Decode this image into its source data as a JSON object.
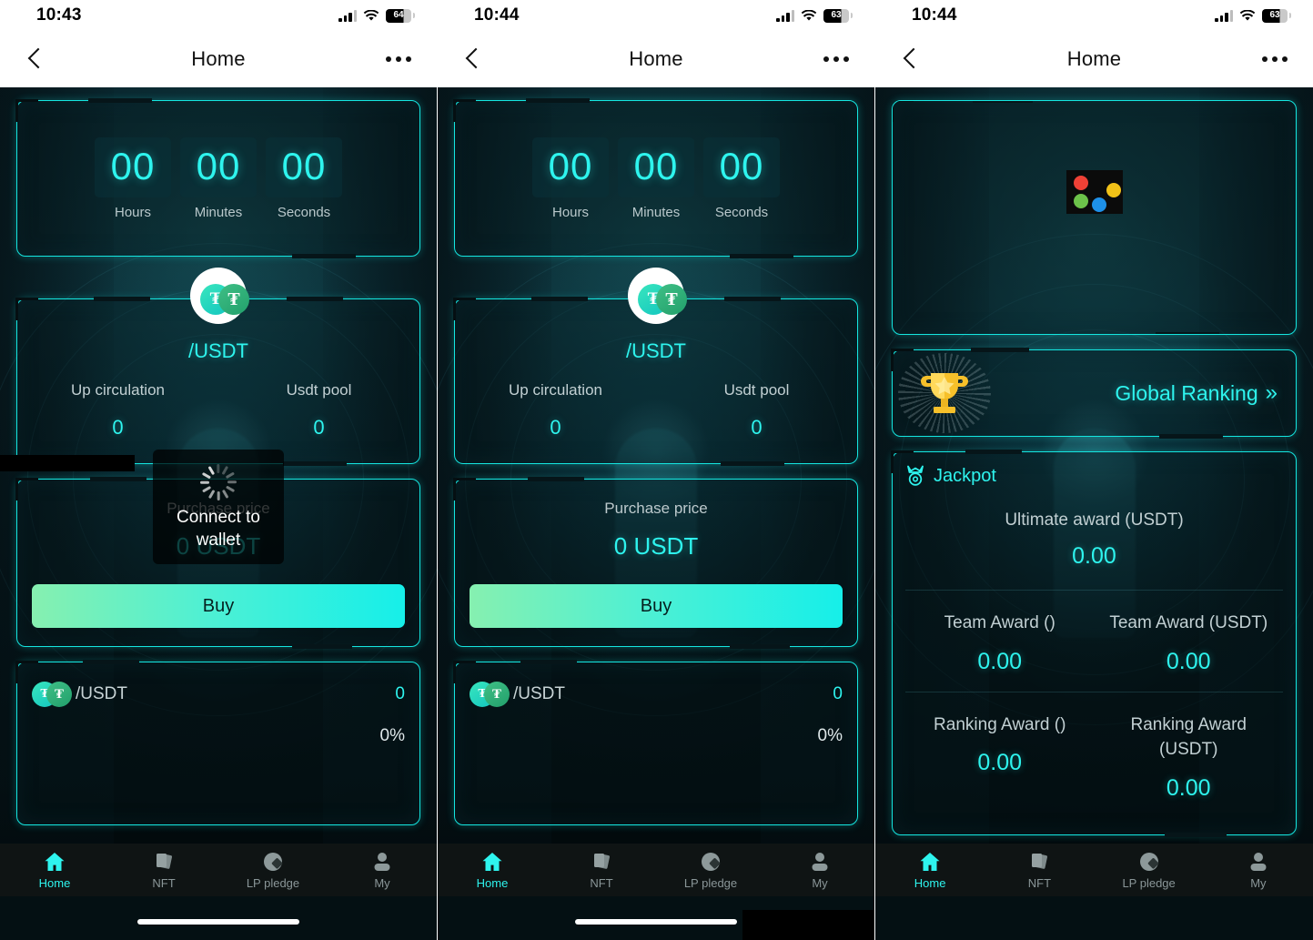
{
  "app": {
    "nav_title": "Home",
    "back_icon": "chevron-left-icon",
    "more_icon": "ellipsis-icon"
  },
  "screens": [
    {
      "status": {
        "time": "10:43",
        "battery": "64",
        "signal_icon": "cellular-signal-icon",
        "wifi_icon": "wifi-icon",
        "battery_icon": "battery-icon"
      },
      "countdown": {
        "cells": [
          {
            "value": "00",
            "label": "Hours"
          },
          {
            "value": "00",
            "label": "Minutes"
          },
          {
            "value": "00",
            "label": "Seconds"
          }
        ]
      },
      "pool": {
        "pair": "/USDT",
        "token_a_glyph": "₮",
        "token_b_glyph": "₮",
        "stats": [
          {
            "label": "Up circulation",
            "value": "0"
          },
          {
            "label": "Usdt pool",
            "value": "0"
          }
        ]
      },
      "purchase": {
        "label": "Purchase price",
        "value": "0 USDT",
        "buy_label": "Buy"
      },
      "list": {
        "pair": "/USDT",
        "amount": "0",
        "percent": "0%"
      },
      "toast": {
        "text": "Connect to wallet",
        "spinner_icon": "loading-spinner-icon"
      }
    },
    {
      "status": {
        "time": "10:44",
        "battery": "63"
      },
      "countdown": {
        "cells": [
          {
            "value": "00",
            "label": "Hours"
          },
          {
            "value": "00",
            "label": "Minutes"
          },
          {
            "value": "00",
            "label": "Seconds"
          }
        ]
      },
      "pool": {
        "pair": "/USDT",
        "stats": [
          {
            "label": "Up circulation",
            "value": "0"
          },
          {
            "label": "Usdt pool",
            "value": "0"
          }
        ]
      },
      "purchase": {
        "label": "Purchase price",
        "value": "0 USDT",
        "buy_label": "Buy"
      },
      "list": {
        "pair": "/USDT",
        "amount": "0",
        "percent": "0%"
      }
    },
    {
      "status": {
        "time": "10:44",
        "battery": "63"
      },
      "hero": {
        "broken_image_icon": "broken-image-placeholder-icon"
      },
      "ranking": {
        "label": "Global Ranking",
        "trophy_icon": "trophy-icon",
        "chevron_icon": "double-chevron-right-icon"
      },
      "jackpot": {
        "title": "Jackpot",
        "title_icon": "medal-icon",
        "ultimate": {
          "label": "Ultimate award (USDT)",
          "value": "0.00"
        },
        "rows": [
          [
            {
              "label": "Team Award ()",
              "value": "0.00"
            },
            {
              "label": "Team Award (USDT)",
              "value": "0.00"
            }
          ],
          [
            {
              "label": "Ranking Award ()",
              "value": "0.00"
            },
            {
              "label": "Ranking Award (USDT)",
              "value": "0.00"
            }
          ]
        ]
      }
    }
  ],
  "tabbar": {
    "items": [
      {
        "label": "Home",
        "icon": "home-icon",
        "active": true
      },
      {
        "label": "NFT",
        "icon": "cards-icon",
        "active": false
      },
      {
        "label": "LP pledge",
        "icon": "diamond-circle-icon",
        "active": false
      },
      {
        "label": "My",
        "icon": "person-icon",
        "active": false
      }
    ]
  },
  "colors": {
    "accent": "#2EF4EE",
    "border": "#15E6E0",
    "bg": "#061519",
    "tab_inactive": "#8A9698"
  }
}
